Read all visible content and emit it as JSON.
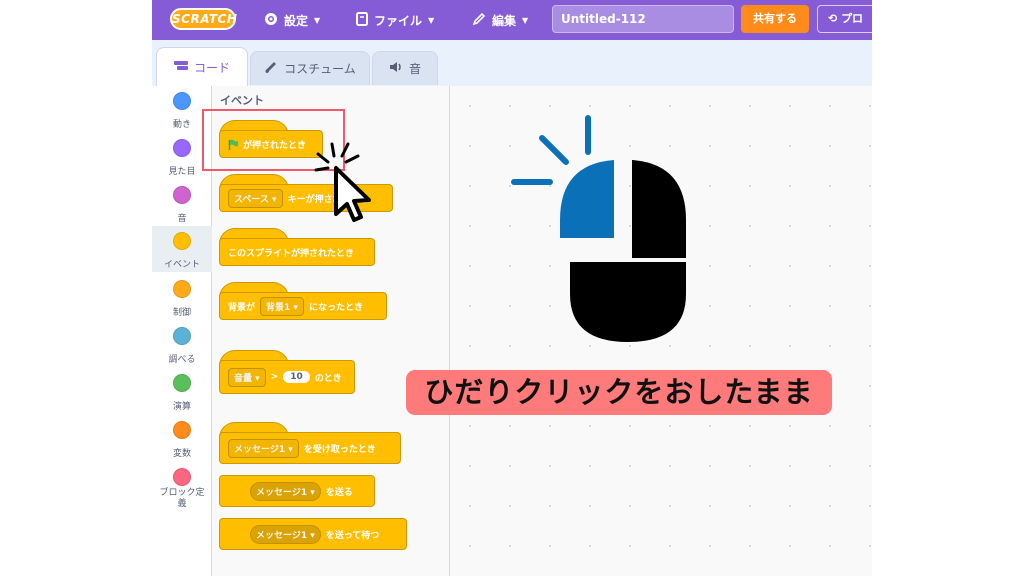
{
  "menubar": {
    "logo": "SCRATCH",
    "settings_label": "設定",
    "file_label": "ファイル",
    "edit_label": "編集",
    "project_title": "Untitled-112",
    "share_label": "共有する",
    "project_page_label": "プロ"
  },
  "tabs": [
    {
      "label": "コード",
      "active": true
    },
    {
      "label": "コスチューム",
      "active": false
    },
    {
      "label": "音",
      "active": false
    }
  ],
  "categories": [
    {
      "label": "動き",
      "color": "#4c97ff"
    },
    {
      "label": "見た目",
      "color": "#9966ff"
    },
    {
      "label": "音",
      "color": "#cf63cf"
    },
    {
      "label": "イベント",
      "color": "#ffbf00",
      "selected": true
    },
    {
      "label": "制御",
      "color": "#ffab19"
    },
    {
      "label": "調べる",
      "color": "#5cb1d6"
    },
    {
      "label": "演算",
      "color": "#59c059"
    },
    {
      "label": "変数",
      "color": "#ff8c1a"
    },
    {
      "label": "ブロック定義",
      "color": "#ff6680"
    }
  ],
  "palette": {
    "heading": "イベント",
    "blocks": {
      "flag_clicked": "が押されたとき",
      "key_dropdown": "スペース",
      "key_pressed": "キーが押されたとき",
      "sprite_clicked": "このスプライトが押されたとき",
      "backdrop_prefix": "背景が",
      "backdrop_dropdown": "背景1",
      "backdrop_suffix": "になったとき",
      "loudness_dropdown": "音量",
      "gt": ">",
      "loudness_value": "10",
      "loudness_suffix": "のとき",
      "message_dropdown": "メッセージ1",
      "receive_suffix": "を受け取ったとき",
      "broadcast_suffix": "を送る",
      "broadcast_wait_suffix": "を送って待つ"
    }
  },
  "caption": "ひだりクリックをおしたまま",
  "colors": {
    "accent": "#855cd6",
    "events": "#ffbf00",
    "highlight": "#ef5a6a",
    "mouse_left": "#0a71b9",
    "caption_bg": "#ff7b7b"
  },
  "icons": [
    "gear-icon",
    "file-icon",
    "pencil-icon",
    "code-icon",
    "brush-icon",
    "speaker-icon",
    "green-flag-icon",
    "cursor-icon",
    "mouse-icon"
  ]
}
